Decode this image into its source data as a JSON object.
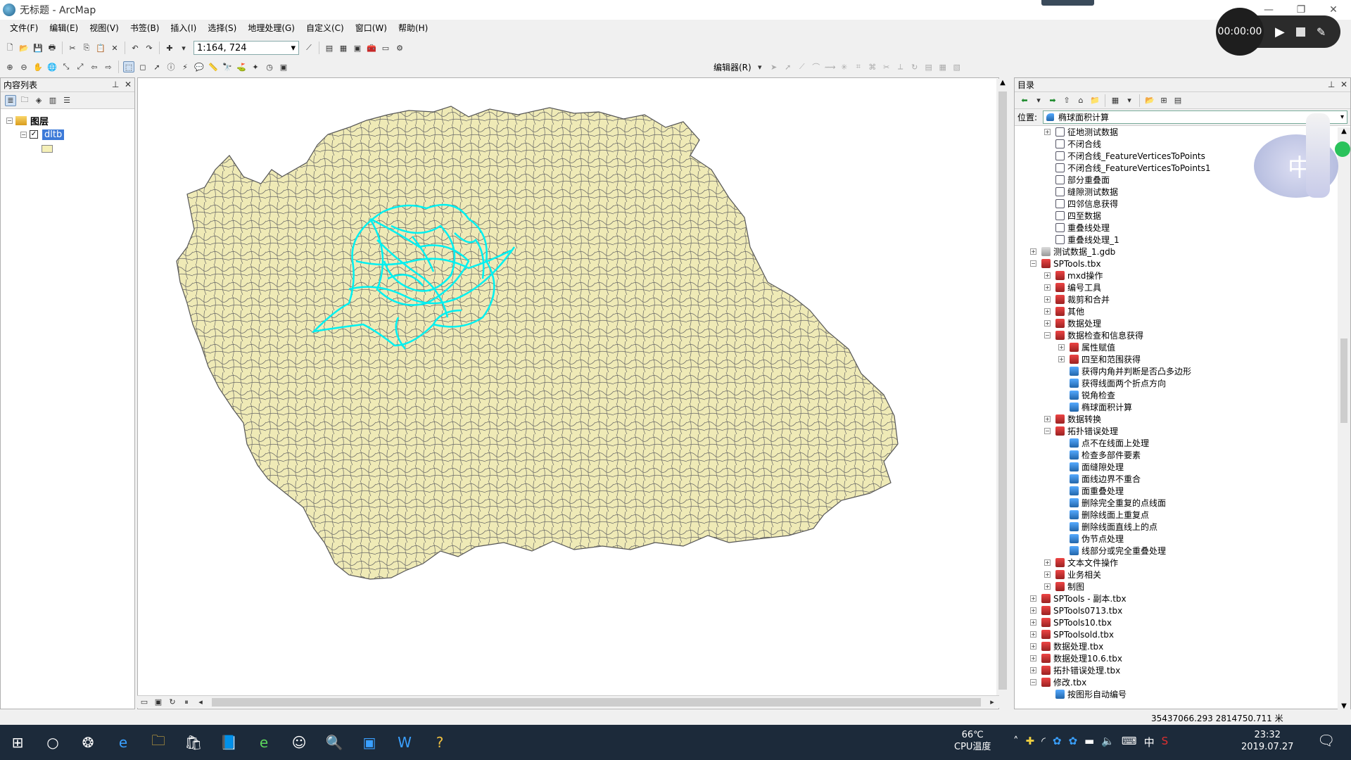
{
  "window": {
    "title": "无标题 - ArcMap",
    "minimize_glyph": "—",
    "restore_glyph": "❐",
    "close_glyph": "✕"
  },
  "menu": [
    "文件(F)",
    "编辑(E)",
    "视图(V)",
    "书签(B)",
    "插入(I)",
    "选择(S)",
    "地理处理(G)",
    "自定义(C)",
    "窗口(W)",
    "帮助(H)"
  ],
  "toolbar": {
    "scale": "1:164, 724",
    "editor_label": "编辑器(R)"
  },
  "toc": {
    "title": "内容列表",
    "root_label": "图层",
    "layer_name": "dltb",
    "layer_checked": true,
    "symbol_fill": "#f5f0b8"
  },
  "catalog": {
    "title": "目录",
    "location_label": "位置:",
    "location_value": "椭球面积计算",
    "items": [
      {
        "label": "征地测试数据",
        "icon": "fc",
        "level": 2,
        "expander": "+"
      },
      {
        "label": "不闭合线",
        "icon": "fc",
        "level": 2,
        "expander": ""
      },
      {
        "label": "不闭合线_FeatureVerticesToPoints",
        "icon": "fc",
        "level": 2,
        "expander": ""
      },
      {
        "label": "不闭合线_FeatureVerticesToPoints1",
        "icon": "fc",
        "level": 2,
        "expander": ""
      },
      {
        "label": "部分重叠面",
        "icon": "fc",
        "level": 2,
        "expander": ""
      },
      {
        "label": "缝隙测试数据",
        "icon": "fc",
        "level": 2,
        "expander": ""
      },
      {
        "label": "四邻信息获得",
        "icon": "fc",
        "level": 2,
        "expander": ""
      },
      {
        "label": "四至数据",
        "icon": "fc",
        "level": 2,
        "expander": ""
      },
      {
        "label": "重叠线处理",
        "icon": "fc",
        "level": 2,
        "expander": ""
      },
      {
        "label": "重叠线处理_1",
        "icon": "fc",
        "level": 2,
        "expander": ""
      },
      {
        "label": "测试数据_1.gdb",
        "icon": "gdb",
        "level": 1,
        "expander": "+"
      },
      {
        "label": "SPTools.tbx",
        "icon": "tbx",
        "level": 1,
        "expander": "−"
      },
      {
        "label": "mxd操作",
        "icon": "tbx",
        "level": 2,
        "expander": "+"
      },
      {
        "label": "编号工具",
        "icon": "tbx",
        "level": 2,
        "expander": "+"
      },
      {
        "label": "裁剪和合并",
        "icon": "tbx",
        "level": 2,
        "expander": "+"
      },
      {
        "label": "其他",
        "icon": "tbx",
        "level": 2,
        "expander": "+"
      },
      {
        "label": "数据处理",
        "icon": "tbx",
        "level": 2,
        "expander": "+"
      },
      {
        "label": "数据检查和信息获得",
        "icon": "tbx",
        "level": 2,
        "expander": "−"
      },
      {
        "label": "属性赋值",
        "icon": "tbx",
        "level": 3,
        "expander": "+"
      },
      {
        "label": "四至和范围获得",
        "icon": "tbx",
        "level": 3,
        "expander": "+"
      },
      {
        "label": "获得内角并判断是否凸多边形",
        "icon": "tool",
        "level": 3,
        "expander": ""
      },
      {
        "label": "获得线面两个折点方向",
        "icon": "tool",
        "level": 3,
        "expander": ""
      },
      {
        "label": "锐角检查",
        "icon": "tool",
        "level": 3,
        "expander": ""
      },
      {
        "label": "椭球面积计算",
        "icon": "tool",
        "level": 3,
        "expander": ""
      },
      {
        "label": "数据转换",
        "icon": "tbx",
        "level": 2,
        "expander": "+"
      },
      {
        "label": "拓扑错误处理",
        "icon": "tbx",
        "level": 2,
        "expander": "−"
      },
      {
        "label": "点不在线面上处理",
        "icon": "tool",
        "level": 3,
        "expander": ""
      },
      {
        "label": "检查多部件要素",
        "icon": "tool",
        "level": 3,
        "expander": ""
      },
      {
        "label": "面缝隙处理",
        "icon": "tool",
        "level": 3,
        "expander": ""
      },
      {
        "label": "面线边界不重合",
        "icon": "tool",
        "level": 3,
        "expander": ""
      },
      {
        "label": "面重叠处理",
        "icon": "tool",
        "level": 3,
        "expander": ""
      },
      {
        "label": "删除完全重复的点线面",
        "icon": "tool",
        "level": 3,
        "expander": ""
      },
      {
        "label": "删除线面上重复点",
        "icon": "tool",
        "level": 3,
        "expander": ""
      },
      {
        "label": "删除线面直线上的点",
        "icon": "tool",
        "level": 3,
        "expander": ""
      },
      {
        "label": "伪节点处理",
        "icon": "tool",
        "level": 3,
        "expander": ""
      },
      {
        "label": "线部分或完全重叠处理",
        "icon": "tool",
        "level": 3,
        "expander": ""
      },
      {
        "label": "文本文件操作",
        "icon": "tbx",
        "level": 2,
        "expander": "+"
      },
      {
        "label": "业务相关",
        "icon": "tbx",
        "level": 2,
        "expander": "+"
      },
      {
        "label": "制图",
        "icon": "tbx",
        "level": 2,
        "expander": "+"
      },
      {
        "label": "SPTools - 副本.tbx",
        "icon": "tbx",
        "level": 1,
        "expander": "+"
      },
      {
        "label": "SPTools0713.tbx",
        "icon": "tbx",
        "level": 1,
        "expander": "+"
      },
      {
        "label": "SPTools10.tbx",
        "icon": "tbx",
        "level": 1,
        "expander": "+"
      },
      {
        "label": "SPToolsold.tbx",
        "icon": "tbx",
        "level": 1,
        "expander": "+"
      },
      {
        "label": "数据处理.tbx",
        "icon": "tbx",
        "level": 1,
        "expander": "+"
      },
      {
        "label": "数据处理10.6.tbx",
        "icon": "tbx",
        "level": 1,
        "expander": "+"
      },
      {
        "label": "拓扑错误处理.tbx",
        "icon": "tbx",
        "level": 1,
        "expander": "+"
      },
      {
        "label": "修改.tbx",
        "icon": "tbx",
        "level": 1,
        "expander": "−"
      },
      {
        "label": "按图形自动编号",
        "icon": "tool",
        "level": 2,
        "expander": ""
      }
    ]
  },
  "map": {
    "fill_color": "#efeab6",
    "outline_color": "#555555",
    "selection_color": "#00f0f0"
  },
  "status": {
    "coordinates": "35437066.293  2814750.711 米"
  },
  "recorder": {
    "time": "00:00:00"
  },
  "overlay": {
    "char": "中"
  },
  "taskbar": {
    "temperature": "66℃",
    "temperature_label": "CPU温度",
    "ime": "中",
    "time": "23:32",
    "date": "2019.07.27"
  }
}
